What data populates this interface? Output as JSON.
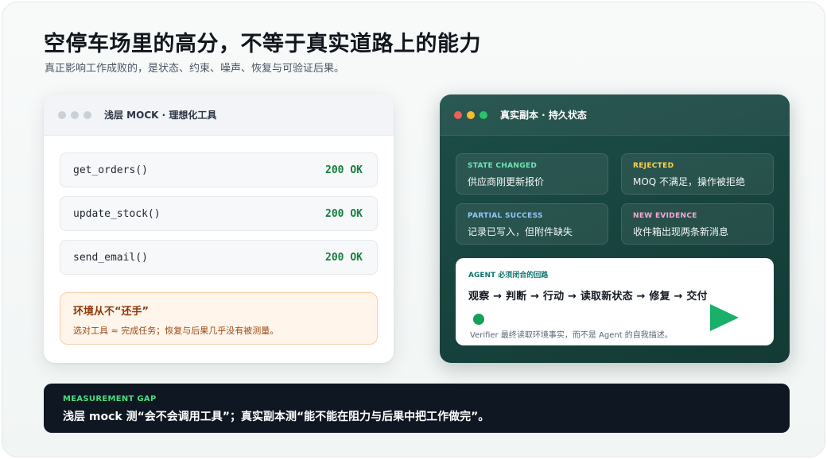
{
  "header": {
    "title": "空停车场里的高分，不等于真实道路上的能力",
    "subtitle": "真正影响工作成败的，是状态、约束、噪声、恢复与可验证后果。"
  },
  "left_panel": {
    "title": "浅层 MOCK · 理想化工具",
    "calls": [
      {
        "name": "get_orders()",
        "status": "200 OK"
      },
      {
        "name": "update_stock()",
        "status": "200 OK"
      },
      {
        "name": "send_email()",
        "status": "200 OK"
      }
    ],
    "warning": {
      "title": "环境从不“还手”",
      "text": "选对工具 ≈ 完成任务；恢复与后果几乎没有被测量。"
    }
  },
  "right_panel": {
    "title": "真实副本 · 持久状态",
    "tiles": [
      {
        "tag": "STATE CHANGED",
        "text": "供应商刚更新报价",
        "color": "#6ee7b7"
      },
      {
        "tag": "REJECTED",
        "text": "MOQ 不满足，操作被拒绝",
        "color": "#fcd34d"
      },
      {
        "tag": "PARTIAL SUCCESS",
        "text": "记录已写入，但附件缺失",
        "color": "#93c5fd"
      },
      {
        "tag": "NEW EVIDENCE",
        "text": "收件箱出现两条新消息",
        "color": "#f9a8d4"
      }
    ],
    "loop": {
      "label": "AGENT 必须闭合的回路",
      "steps": "观察 → 判断 → 行动 → 读取新状态 → 修复 → 交付",
      "note": "Verifier 最终读取环境事实，而不是 Agent 的自我描述。"
    }
  },
  "banner": {
    "tag": "MEASUREMENT GAP",
    "text": "浅层 mock 测“会不会调用工具”；真实副本测“能不能在阻力与后果中把工作做完”。"
  },
  "colors": {
    "ok_green": "#15803d",
    "dark_teal": "#1d4e48",
    "banner_bg": "#0f1722",
    "accent_green": "#4ade80"
  }
}
